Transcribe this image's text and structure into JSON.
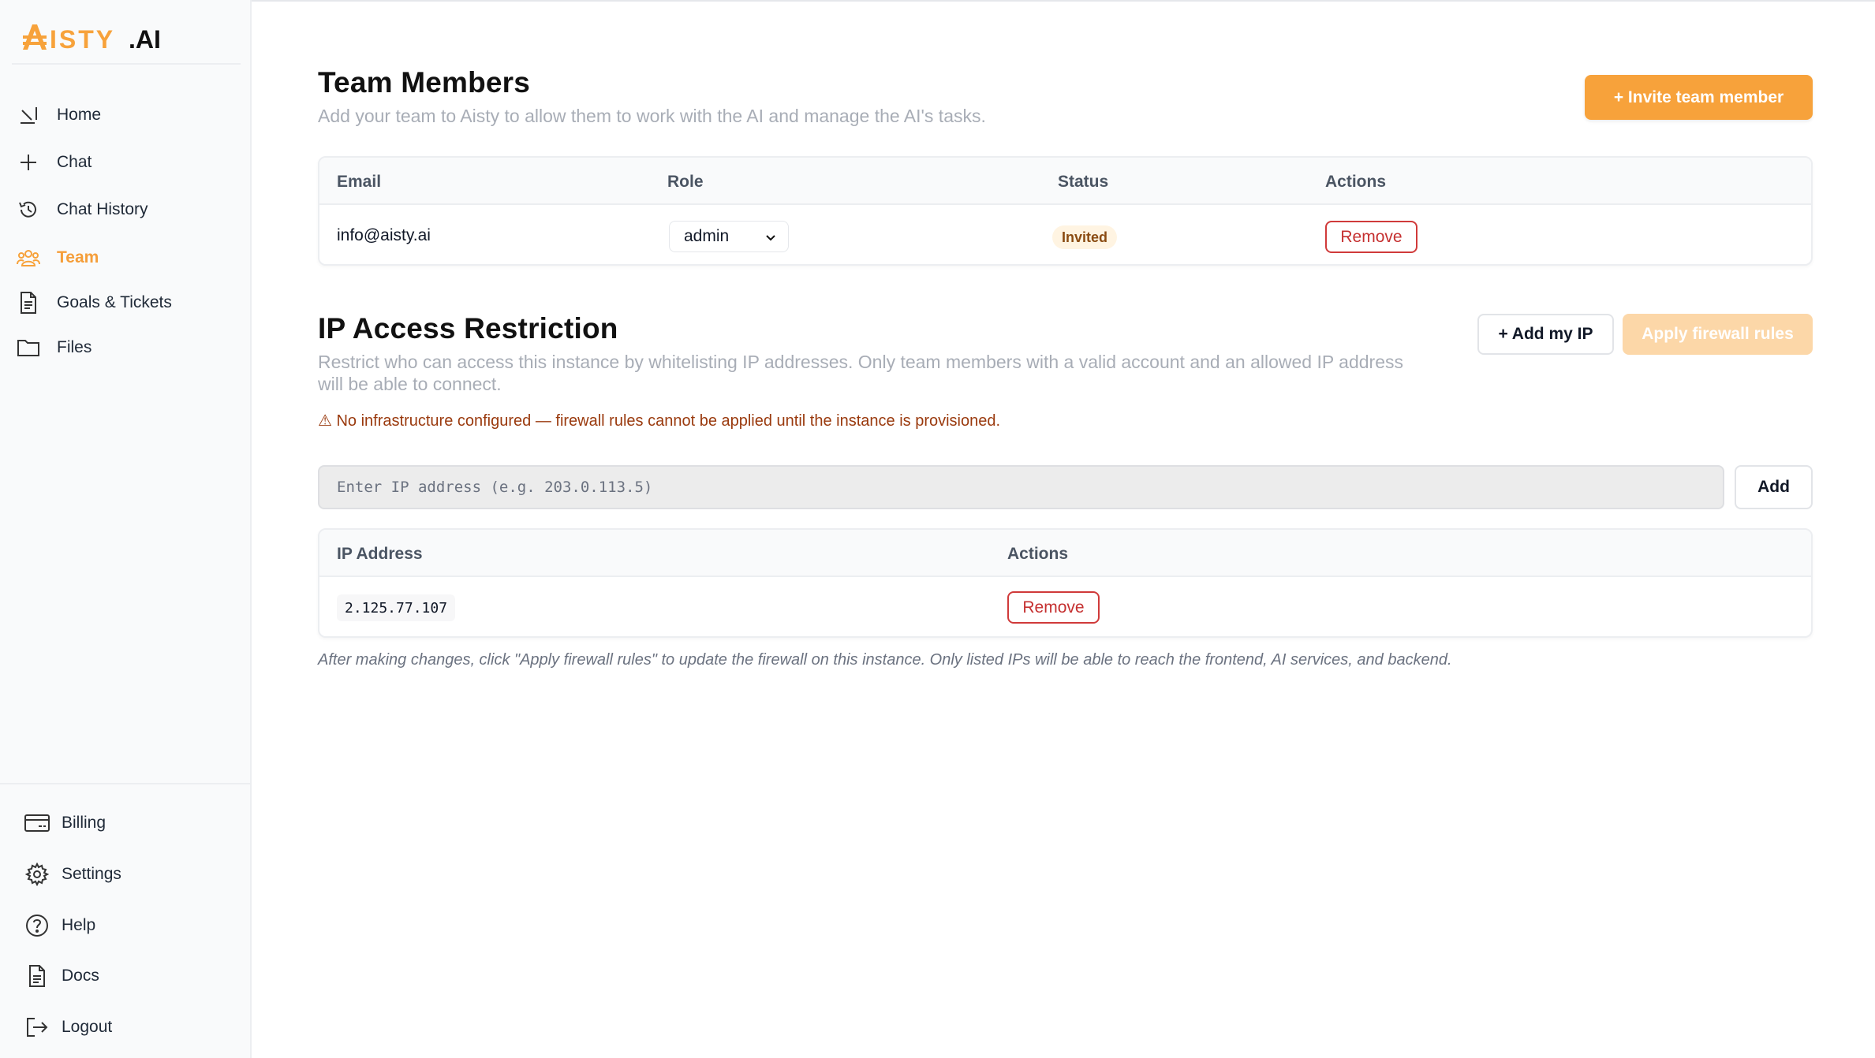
{
  "app": {
    "logo_text": "AISTY.AI",
    "brand_color": "#f7a23b"
  },
  "sidebar": {
    "items": [
      {
        "label": "Home",
        "icon": "home-icon"
      },
      {
        "label": "Chat",
        "icon": "plus-icon"
      },
      {
        "label": "Chat History",
        "icon": "history-icon"
      },
      {
        "label": "Team",
        "icon": "team-icon",
        "active": true
      },
      {
        "label": "Goals & Tickets",
        "icon": "document-icon"
      },
      {
        "label": "Files",
        "icon": "folder-icon"
      }
    ],
    "bottom_items": [
      {
        "label": "Billing",
        "icon": "billing-icon"
      },
      {
        "label": "Settings",
        "icon": "gear-icon"
      },
      {
        "label": "Help",
        "icon": "help-icon"
      },
      {
        "label": "Docs",
        "icon": "docs-icon"
      },
      {
        "label": "Logout",
        "icon": "logout-icon"
      }
    ]
  },
  "team": {
    "title": "Team Members",
    "subtitle": "Add your team to Aisty to allow them to work with the AI and manage the AI's tasks.",
    "invite_button": "+ Invite team member",
    "columns": [
      "Email",
      "Role",
      "Status",
      "Actions"
    ],
    "rows": [
      {
        "email": "info@aisty.ai",
        "role": "admin",
        "status": "Invited",
        "action": "Remove"
      }
    ]
  },
  "ip_access": {
    "title": "IP Access Restriction",
    "subtitle_line1": "Restrict who can access this instance by whitelisting IP addresses. Only team members with a valid account and an allowed IP address",
    "subtitle_line2": "will be able to connect.",
    "add_my_ip_button": "+ Add my IP",
    "apply_button": "Apply firewall rules",
    "warning": "⚠ No infrastructure configured — firewall rules cannot be applied until the instance is provisioned.",
    "input_placeholder": "Enter IP address (e.g. 203.0.113.5)",
    "add_button": "Add",
    "columns": [
      "IP Address",
      "Actions"
    ],
    "rows": [
      {
        "ip": "2.125.77.107",
        "action": "Remove"
      }
    ],
    "footnote": "After making changes, click \"Apply firewall rules\" to update the firewall on this instance. Only listed IPs will be able to reach the frontend, AI services, and backend."
  }
}
